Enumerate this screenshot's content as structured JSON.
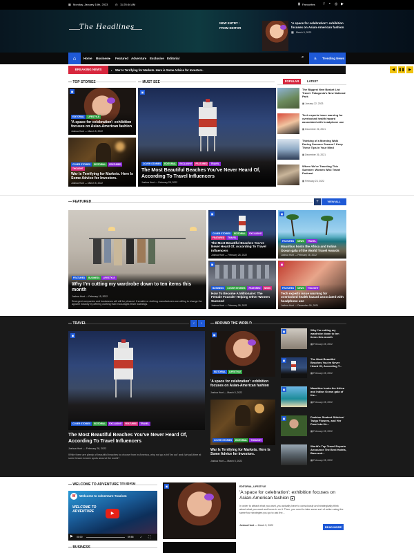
{
  "topbar": {
    "date": "Monday, January 16th, 2023",
    "time": "11:25:44 AM",
    "favourites": "Favourites"
  },
  "header": {
    "logo": "The Headlines",
    "new_entry": "NEW ENTRY :",
    "from_editor": "FROM EDITOR",
    "featured_title": "'A space for celebration': exhibition focuses on Asian-American fashion",
    "featured_date": "March 5, 2022"
  },
  "nav": {
    "items": [
      "Home",
      "Business",
      "Featured",
      "Adventure",
      "Exclusive",
      "Editorial"
    ],
    "trending": "Trending News"
  },
  "ticker": {
    "label": "BREAKING NEWS",
    "text": "War Is Terrifying for Markets. Here is Some Advice for Investors."
  },
  "top_stories": {
    "title": "TOP STORIES",
    "items": [
      {
        "tags": [
          "EDITORIAL",
          "LIFESTYLE"
        ],
        "title": "'A space for celebration': exhibition focuses on Asian-American fashion",
        "author": "Joshua Hunt",
        "date": "March 5, 2022"
      },
      {
        "tags": [
          "COVER STORIES",
          "EDITORIAL",
          "FEATURED",
          "THOUGHT"
        ],
        "title": "War Is Terrifying for Markets. Here Is Some Advice for Investors.",
        "author": "Joshua Hunt",
        "date": "March 5, 2022"
      }
    ]
  },
  "must_see": {
    "title": "MUST SEE",
    "tags": [
      "COVER STORIES",
      "EDITORIAL",
      "EXCLUSIVE",
      "FEATURED",
      "TRAVEL"
    ],
    "headline": "The Most Beautiful Beaches You've Never Heard Of, According To Travel Influencers",
    "author": "Joshua Hunt",
    "date": "February 28, 2022"
  },
  "sidebar": {
    "tab_popular": "POPULAR",
    "tab_latest": "LATEST",
    "items": [
      {
        "title": "The Biggest New Basket List Travel: Patagonia's New National Park",
        "date": "January 22, 2023"
      },
      {
        "title": "Tech experts issue warning for overlooked health hazard associated with headphone use",
        "date": "December 26, 2021"
      },
      {
        "title": "Thinking of a Morning Walk During Summer Season? Keep These Tips in Your Mind",
        "date": "December 26, 2021"
      },
      {
        "title": "Where We're Traveling This Summer: Women Who Travel Podcast",
        "date": "February 23, 2022"
      }
    ]
  },
  "featured": {
    "title": "FEATURED",
    "view_all": "VIEW ALL",
    "main": {
      "tags": [
        "FEATURED",
        "BUSINESS",
        "LIFESTYLE"
      ],
      "title": "Why I'm cutting my wardrobe down to ten items this month",
      "author": "Joshua Hunt",
      "date": "February 19, 2022",
      "excerpt": "Emergent companies and businesses will still be pleased. If smaller or clothing manufacturers are willing to change the apparel industry by offering clothing that encourages fewer washings."
    },
    "cards": [
      {
        "tags": [
          "COVER STORIES",
          "EDITORIAL",
          "EXCLUSIVE",
          "FEATURED",
          "TRAVEL"
        ],
        "title": "The Most Beautiful Beaches You've Never Heard Of, According To Travel Influencers",
        "author": "Joshua Hunt",
        "date": "February 28, 2022"
      },
      {
        "tags": [
          "FEATURED",
          "NEWS",
          "TRAVEL"
        ],
        "title": "Mauritius hosts the Africa and Indian Ocean gala of the World Travel Awards",
        "author": "Joshua Hunt",
        "date": "February 28, 2022"
      },
      {
        "tags": [
          "BUSINESS",
          "COVER STORIES",
          "FEATURED",
          "NEWS"
        ],
        "title": "How To Become A Millionaire: The Female Founder Helping Other Women Succeed",
        "author": "Joshua Hunt",
        "date": "February 28, 2022"
      },
      {
        "tags": [
          "FEATURED",
          "NEWS",
          "THOUGHT"
        ],
        "title": "Tech experts issue warning for overlooked health hazard associated with headphone use",
        "author": "Joshua Hunt",
        "date": "December 26, 2021"
      }
    ]
  },
  "travel": {
    "title": "TRAVEL",
    "tags": [
      "COVER STORIES",
      "EDITORIAL",
      "EXCLUSIVE",
      "FEATURED",
      "TRAVEL"
    ],
    "headline": "The Most Beautiful Beaches You've Never Heard Of, According To Travel Influencers",
    "author": "Joshua Hunt",
    "date": "February 28, 2022",
    "excerpt": "While there are plenty of beautiful beaches to choose from in America, why not go a bit 'far out' and (virtual) time at some lesser-known spots around the world?"
  },
  "around": {
    "title": "AROUND THE WORLD",
    "big": [
      {
        "tags": [
          "EDITORIAL",
          "LIFESTYLE"
        ],
        "title": "'A space for celebration': exhibition focuses on Asian-American fashion",
        "author": "Joshua Hunt",
        "date": "March 5, 2022"
      },
      {
        "tags": [
          "COVER STORIES",
          "EDITORIAL",
          "THOUGHT"
        ],
        "title": "War Is Terrifying for Markets. Here Is Some Advice for Investors.",
        "author": "Joshua Hunt",
        "date": "March 5, 2022"
      }
    ],
    "small": [
      {
        "title": "Why I'm cutting my wardrobe down to ten items this month",
        "date": "February 28, 2022"
      },
      {
        "title": "The Most Beautiful Beaches You've Never Heard Of, According T...",
        "date": "February 28, 2022"
      },
      {
        "title": "Mauritius hosts the Africa and Indian Ocean gala of the...",
        "date": "February 28, 2022"
      },
      {
        "title": "Fashion Student Stitches' Twigs Flowers, and Her Face Into He...",
        "date": "February 28, 2022"
      },
      {
        "title": "World's Top Travel Experts Announce The Best Hotels, Bars and...",
        "date": "February 28, 2022"
      }
    ]
  },
  "adventure": {
    "title": "WELCOME TO ADVENTURE TOURISM",
    "video_title": "Welcome to Adventure Tourism",
    "brand": "WELCOME TO ADVENTURE",
    "time_cur": "00:00",
    "time_total": "09:55"
  },
  "business": {
    "title": "BUSINESS"
  },
  "bottom_article": {
    "tags": [
      "EDITORIAL",
      "LIFESTYLE"
    ],
    "title": "'A space for celebration': exhibition focuses on Asian-American fashion",
    "excerpt": "In order to attract what you want, you actually have to consciously and strategically think about what you want and focus in on it. Then, you need to take some sort of action using the same four strategies you go to ask the...",
    "author": "Joshua Hunt",
    "date": "March 5, 2022",
    "read_more": "READ MORE"
  },
  "colors": {
    "accent": "#1e59d6",
    "breaking": "#d7263d",
    "popular": "#d7263d"
  }
}
